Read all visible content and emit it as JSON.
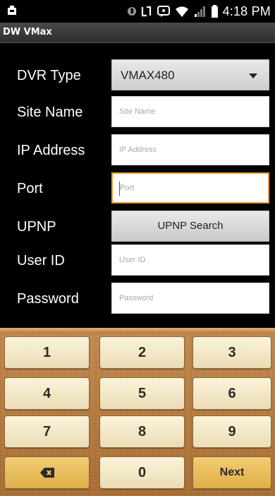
{
  "status_bar": {
    "time": "4:18 PM",
    "icons": [
      "screenshot-notification-icon",
      "bluetooth-icon",
      "nfc-icon",
      "data-sync-icon",
      "wifi-icon",
      "signal-icon",
      "battery-icon"
    ]
  },
  "app": {
    "title": "DW VMax"
  },
  "form": {
    "dvr_type": {
      "label": "DVR Type",
      "value": "VMAX480"
    },
    "site_name": {
      "label": "Site Name",
      "placeholder": "Site Name",
      "value": ""
    },
    "ip_address": {
      "label": "IP Address",
      "placeholder": "IP Address",
      "value": ""
    },
    "port": {
      "label": "Port",
      "placeholder": "Port",
      "value": "",
      "focused": true
    },
    "upnp": {
      "label": "UPNP",
      "button_label": "UPNP Search"
    },
    "user_id": {
      "label": "User ID",
      "placeholder": "User ID",
      "value": ""
    },
    "password": {
      "label": "Password",
      "placeholder": "Password",
      "value": ""
    }
  },
  "keypad": {
    "keys": [
      "1",
      "2",
      "3",
      "4",
      "5",
      "6",
      "7",
      "8",
      "9",
      "",
      "0",
      "Next"
    ],
    "backspace_icon": "backspace-icon",
    "colors": {
      "key": "#f5ebcb",
      "special_key": "#eac060",
      "wood": "#b87d42"
    }
  },
  "colors": {
    "focus_border": "#f09a2c",
    "background": "#000000"
  }
}
